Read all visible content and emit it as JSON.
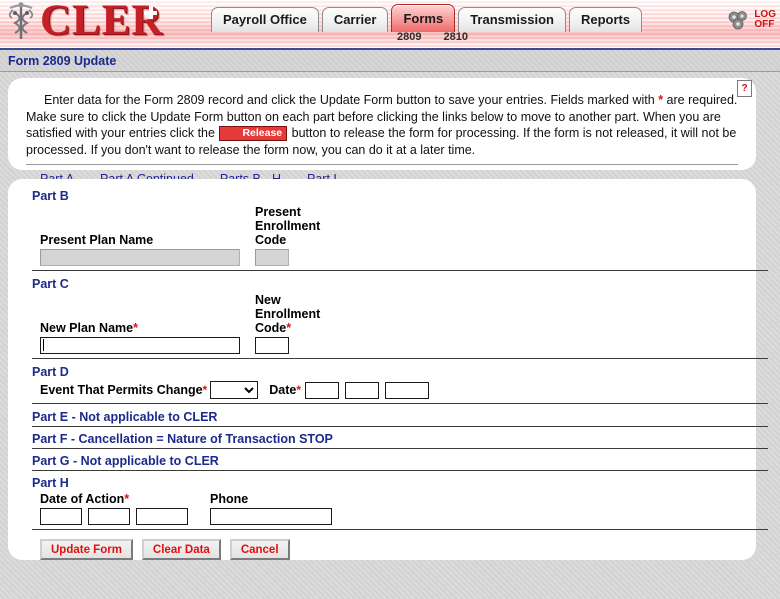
{
  "banner": {
    "logo_text": "CLER",
    "caduceus_icon": "caduceus-icon",
    "tabs": [
      {
        "label": "Payroll Office",
        "active": false
      },
      {
        "label": "Carrier",
        "active": false
      },
      {
        "label": "Forms",
        "active": true
      },
      {
        "label": "Transmission",
        "active": false
      },
      {
        "label": "Reports",
        "active": false
      }
    ],
    "subtabs": [
      "2809",
      "2810"
    ],
    "logoff_label": "LOG\nOFF",
    "gear_icon": "gear-icon",
    "accent_red": "#c62027",
    "tab_active_red": "#ef6a6a",
    "link_blue": "#24248f"
  },
  "title_band": {
    "title": "Form 2809 Update"
  },
  "instructions": {
    "help_icon_label": "?",
    "text_part_1": "Enter data for the Form 2809 record and click the Update Form button to save your entries.  Fields marked with ",
    "required_star": "*",
    "text_part_2": " are required.  Make sure to click the Update Form button on each part before clicking the links below to move to another part.  When you are satisfied with your entries click the ",
    "release_chip_label": "Release",
    "text_part_3": " button to release the form for processing.  If the form is not released, it will not be processed.  If you don't want to release the form now, you can do it at a later time.",
    "part_links": [
      {
        "label": "Part A"
      },
      {
        "label": "Part A Continued"
      },
      {
        "label": "Parts B - H"
      },
      {
        "label": "Part I"
      }
    ]
  },
  "form": {
    "part_b": {
      "heading": "Part B",
      "present_plan_name_label": "Present Plan Name",
      "present_plan_name_value": "",
      "present_enrollment_code_label": "Present\nEnrollment\nCode",
      "present_enrollment_code_value": ""
    },
    "part_c": {
      "heading": "Part C",
      "new_plan_name_label": "New Plan Name",
      "new_plan_name_value": "",
      "new_plan_name_required": "*",
      "new_enrollment_code_label": "New\nEnrollment\nCode",
      "new_enrollment_code_required": "*",
      "new_enrollment_code_value": ""
    },
    "part_d": {
      "heading": "Part D",
      "event_label": "Event That Permits Change",
      "event_required": "*",
      "event_selected": "",
      "event_options": [
        ""
      ],
      "date_label": "Date",
      "date_required": "*",
      "date_month": "",
      "date_day": "",
      "date_year": ""
    },
    "part_e": {
      "heading": "Part E - Not applicable to CLER"
    },
    "part_f": {
      "heading": "Part F - Cancellation = Nature of Transaction STOP"
    },
    "part_g": {
      "heading": "Part G - Not applicable to CLER"
    },
    "part_h": {
      "heading": "Part H",
      "date_of_action_label": "Date of Action",
      "date_of_action_required": "*",
      "date_of_action_month": "",
      "date_of_action_day": "",
      "date_of_action_year": "",
      "phone_label": "Phone",
      "phone_value": ""
    },
    "buttons": [
      {
        "label": "Update Form"
      },
      {
        "label": "Clear Data"
      },
      {
        "label": "Cancel"
      }
    ]
  }
}
